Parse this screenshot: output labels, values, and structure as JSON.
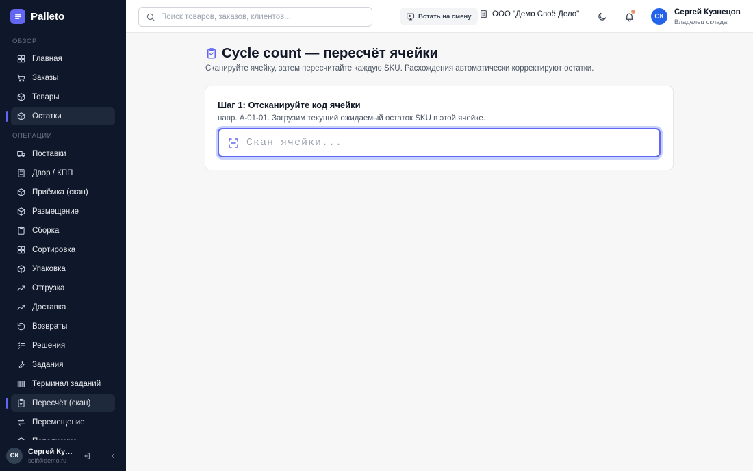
{
  "app": {
    "name": "Palleto"
  },
  "sidebar": {
    "sections": [
      {
        "label": "Обзор",
        "items": [
          {
            "label": "Главная",
            "icon": "grid-icon",
            "active": false
          },
          {
            "label": "Заказы",
            "icon": "cart-icon",
            "active": false
          },
          {
            "label": "Товары",
            "icon": "box-icon",
            "active": false
          },
          {
            "label": "Остатки",
            "icon": "box-icon",
            "active": true
          }
        ]
      },
      {
        "label": "Операции",
        "items": [
          {
            "label": "Поставки",
            "icon": "truck-icon",
            "active": false
          },
          {
            "label": "Двор / КПП",
            "icon": "building-icon",
            "active": false
          },
          {
            "label": "Приёмка (скан)",
            "icon": "box-icon",
            "active": false
          },
          {
            "label": "Размещение",
            "icon": "box-icon",
            "active": false
          },
          {
            "label": "Сборка",
            "icon": "clipboard-icon",
            "active": false
          },
          {
            "label": "Сортировка",
            "icon": "grid-icon",
            "active": false
          },
          {
            "label": "Упаковка",
            "icon": "box-icon",
            "active": false
          },
          {
            "label": "Отгрузка",
            "icon": "trend-icon",
            "active": false
          },
          {
            "label": "Доставка",
            "icon": "trend-icon",
            "active": false
          },
          {
            "label": "Возвраты",
            "icon": "rotate-icon",
            "active": false
          },
          {
            "label": "Решения",
            "icon": "checklist-icon",
            "active": false
          },
          {
            "label": "Задания",
            "icon": "wrench-icon",
            "active": false
          },
          {
            "label": "Терминал заданий",
            "icon": "barcode-icon",
            "active": false
          },
          {
            "label": "Пересчёт (скан)",
            "icon": "clipboard-check-icon",
            "active": true
          },
          {
            "label": "Перемещение",
            "icon": "arrows-icon",
            "active": false
          },
          {
            "label": "Пополнение",
            "icon": "box-icon",
            "active": false
          }
        ]
      }
    ],
    "footer": {
      "initials": "СК",
      "name": "Сергей Кузнецов",
      "email": "self@demo.ru"
    }
  },
  "topbar": {
    "search_placeholder": "Поиск товаров, заказов, клиентов...",
    "shift_button": "Встать на смену",
    "organization": "ООО \"Демо Своё Дело\"",
    "user": {
      "initials": "СК",
      "name": "Сергей Кузнецов",
      "role": "Владелец склада"
    },
    "notification_dot_color": "#e7966b"
  },
  "page": {
    "title": "Cycle count — пересчёт ячейки",
    "subtitle": "Сканируйте ячейку, затем пересчитайте каждую SKU. Расхождения автоматически корректируют остатки."
  },
  "step": {
    "title": "Шаг 1: Отсканируйте код ячейки",
    "hint": "напр. A-01-01. Загрузим текущий ожидаемый остаток SKU в этой ячейке.",
    "input_placeholder": "Скан ячейки...",
    "input_value": ""
  },
  "colors": {
    "accent": "#6366f1",
    "sidebar_bg": "#0f172a",
    "avatar_blue": "#2563eb"
  }
}
